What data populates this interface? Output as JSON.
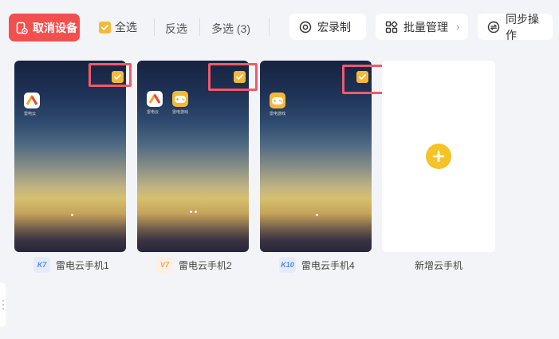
{
  "toolbar": {
    "cancel_label": "取消设备",
    "select_all_label": "全选",
    "invert_label": "反选",
    "multi_select_label": "多选 (3)",
    "macro_label": "宏录制",
    "batch_label": "批量管理",
    "sync_label": "同步操作"
  },
  "devices": [
    {
      "name": "雷电云手机1",
      "badge": "K7",
      "badge_color": "#4f86e6",
      "selected": true,
      "apps": [
        "app-a"
      ],
      "app_labels": [
        "雷电云"
      ]
    },
    {
      "name": "雷电云手机2",
      "badge": "V7",
      "badge_color": "#f0a456",
      "selected": true,
      "apps": [
        "app-a",
        "app-g"
      ],
      "app_labels": [
        "雷电云",
        "雷电游戏"
      ]
    },
    {
      "name": "雷电云手机4",
      "badge": "K10",
      "badge_color": "#4f86e6",
      "selected": true,
      "apps": [
        "app-g"
      ],
      "app_labels": [
        "雷电游戏"
      ]
    }
  ],
  "add_device": {
    "label": "新增云手机",
    "icon": "plus-icon"
  },
  "colors": {
    "accent_red": "#f0504f",
    "check_yellow": "#f5b93a",
    "highlight": "#ef5a6a",
    "add_yellow": "#f5c326"
  }
}
